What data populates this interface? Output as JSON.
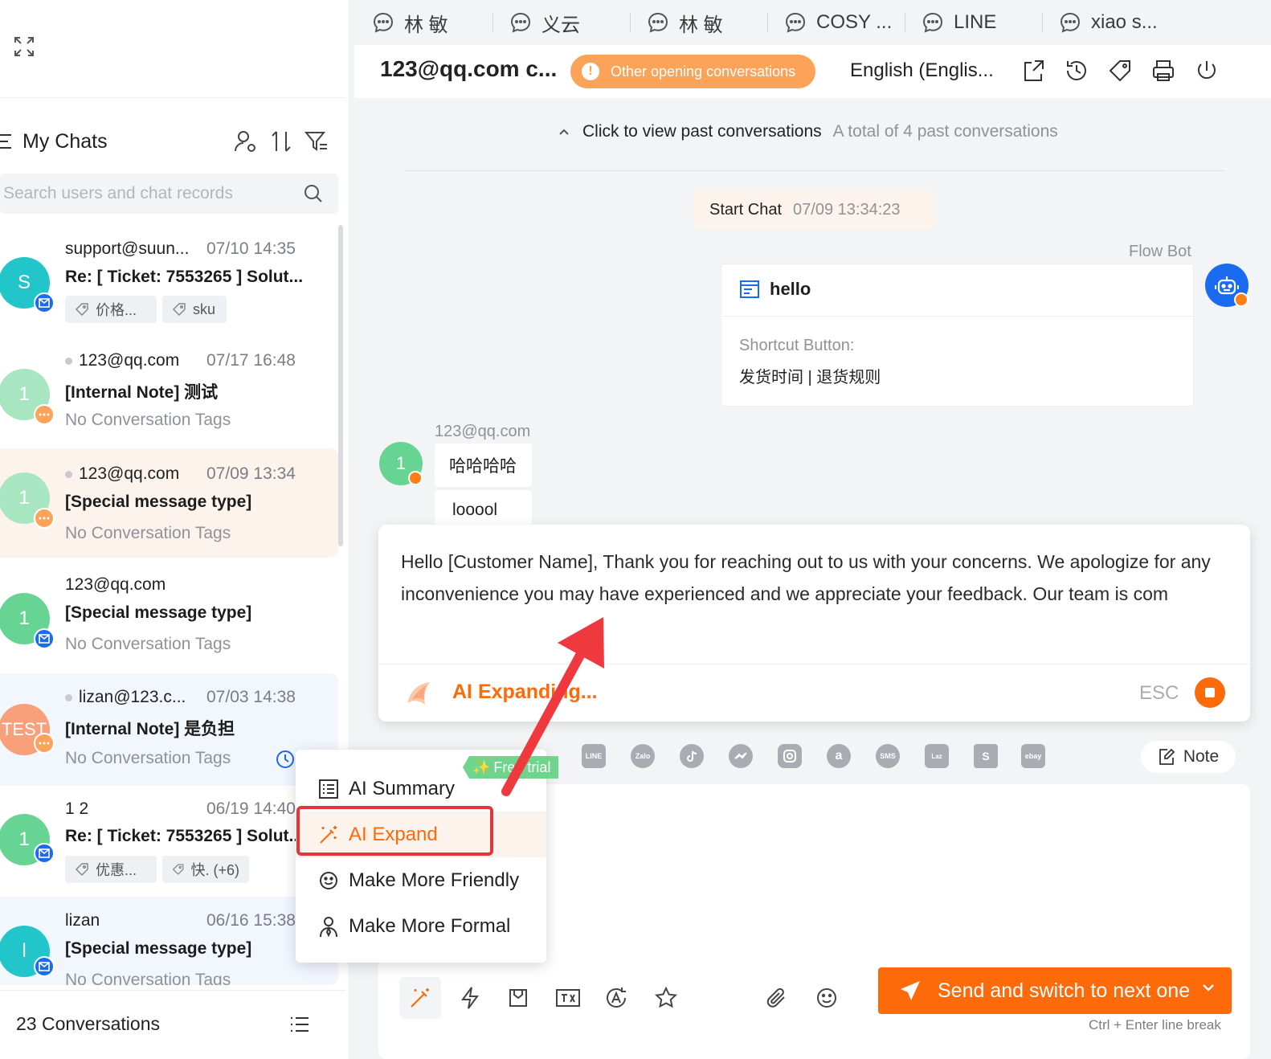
{
  "sidebar": {
    "title": "My Chats",
    "search_placeholder": "Search users and chat records",
    "footer_count": "23 Conversations",
    "chats": [
      {
        "name": "support@suun...",
        "time": "07/10 14:35",
        "message": "Re: [ Ticket: 7553265 ] Solut...",
        "avatar": "S",
        "tags": [
          "价格...",
          "sku"
        ]
      },
      {
        "name": "123@qq.com",
        "time": "07/17 16:48",
        "message": "[Internal Note] 测试",
        "subtitle": "No Conversation Tags",
        "avatar": "1"
      },
      {
        "name": "123@qq.com",
        "time": "07/09 13:34",
        "message": "[Special message type]",
        "subtitle": "No Conversation Tags",
        "avatar": "1"
      },
      {
        "name": "123@qq.com",
        "time": "",
        "message": "[Special message type]",
        "subtitle": "No Conversation Tags",
        "avatar": "1"
      },
      {
        "name": "lizan@123.c...",
        "time": "07/03 14:38",
        "message": "[Internal Note] 是负担",
        "subtitle": "No Conversation Tags",
        "avatar": "TEST"
      },
      {
        "name": "1 2",
        "time": "06/19 14:40",
        "message": "Re: [ Ticket: 7553265 ] Solut...",
        "avatar": "1",
        "tags": [
          "优惠...",
          "快. (+6)"
        ]
      },
      {
        "name": "lizan",
        "time": "06/16 15:38",
        "message": "[Special message type]",
        "subtitle": "No Conversation Tags",
        "avatar": "l"
      }
    ]
  },
  "tabs": [
    "林 敏",
    "义云",
    "林 敏",
    "COSY ...",
    "LINE",
    "xiao s..."
  ],
  "header": {
    "title": "123@qq.com c...",
    "other_pill": "Other opening conversations",
    "language": "English (Englis..."
  },
  "history": {
    "view_past": "Click to view past conversations",
    "past_total": "A total of 4 past conversations",
    "start_chat_label": "Start Chat",
    "start_chat_time": "07/09 13:34:23"
  },
  "bot": {
    "label": "Flow Bot",
    "message": "hello",
    "shortcut_label": "Shortcut Button:",
    "shortcut_value": "发货时间 | 退货规则"
  },
  "customer": {
    "label": "123@qq.com",
    "avatar": "1",
    "messages": [
      "哈哈哈哈",
      "looool"
    ]
  },
  "ai_panel": {
    "text": "Hello [Customer Name], Thank you for reaching out to us with your concerns. We apologize for any inconvenience you may have experienced and we appreciate your feedback. Our team is com",
    "status": "AI Expanding...",
    "esc": "ESC"
  },
  "channels": [
    "LINE",
    "Zalo",
    "TikTok",
    "Messenger",
    "Instagram",
    "Amazon",
    "SMS",
    "Lazada",
    "Shopee",
    "ebay"
  ],
  "note_label": "Note",
  "menu": {
    "badge": "Free trial",
    "items": [
      "AI Summary",
      "AI Expand",
      "Make More Friendly",
      "Make More Formal"
    ]
  },
  "composer": {
    "send_label": "Send and switch to next one",
    "hint": "Ctrl + Enter line break"
  },
  "colors": {
    "accent": "#fd6a0a",
    "highlight": "#e6343c",
    "blue": "#1a6bf0"
  }
}
